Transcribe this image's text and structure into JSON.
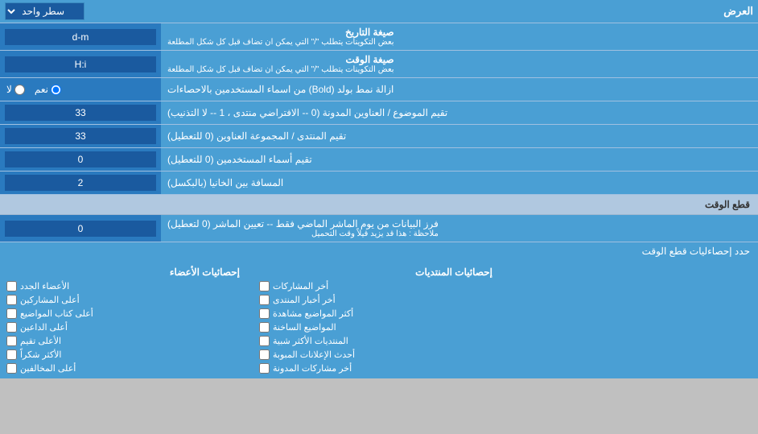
{
  "header": {
    "display_label": "العرض",
    "rows_label": "سطر واحد"
  },
  "rows": [
    {
      "id": "date_format",
      "label": "صيغة التاريخ",
      "sublabel": "بعض التكوينات يتطلب \"/\" التي يمكن ان تضاف قبل كل شكل المطلعة",
      "value": "d-m",
      "type": "text"
    },
    {
      "id": "time_format",
      "label": "صيغة الوقت",
      "sublabel": "بعض التكوينات يتطلب \"/\" التي يمكن ان تضاف قبل كل شكل المطلعة",
      "value": "H:i",
      "type": "text"
    },
    {
      "id": "bold_remove",
      "label": "ازالة نمط بولد (Bold) من اسماء المستخدمين بالاحصاءات",
      "type": "radio",
      "options": [
        {
          "value": "yes",
          "label": "نعم"
        },
        {
          "value": "no",
          "label": "لا"
        }
      ],
      "selected": "yes"
    },
    {
      "id": "topic_order",
      "label": "تقيم الموضوع / العناوين المدونة (0 -- الافتراضي منتدى ، 1 -- لا التذنيب)",
      "value": "33",
      "type": "text"
    },
    {
      "id": "forum_order",
      "label": "تقيم المنتدى / المجموعة العناوين (0 للتعطيل)",
      "value": "33",
      "type": "text"
    },
    {
      "id": "usernames_order",
      "label": "تقيم أسماء المستخدمين (0 للتعطيل)",
      "value": "0",
      "type": "text"
    },
    {
      "id": "spacing",
      "label": "المسافة بين الخانيا (بالبكسل)",
      "value": "2",
      "type": "text"
    }
  ],
  "section_cut": {
    "title": "قطع الوقت",
    "row": {
      "label": "فرز البيانات من يوم الماشر الماضي فقط -- تعيين الماشر (0 لتعطيل)",
      "sublabel": "ملاحظة : هذا قد يزيد قيلاً وقت التحميل",
      "value": "0"
    },
    "limit_label": "حدد إحصاءليات قطع الوقت"
  },
  "checkboxes": {
    "col1_header": "إحصائيات الأعضاء",
    "col1_items": [
      "الأعضاء الجدد",
      "أعلى المشاركين",
      "أعلى كتاب المواضيع",
      "أعلى الداعين",
      "الأعلى تقيم",
      "الأكثر شكراً",
      "أعلى المخالفين"
    ],
    "col2_header": "إحصائيات المنتديات",
    "col2_items": [
      "أخر المشاركات",
      "أخر أخبار المنتدى",
      "أكثر المواضيع مشاهدة",
      "المواضيع الساخنة",
      "المنتديات الأكثر شبية",
      "أحدث الإعلانات المبوبة",
      "أخر مشاركات المدونة"
    ]
  }
}
